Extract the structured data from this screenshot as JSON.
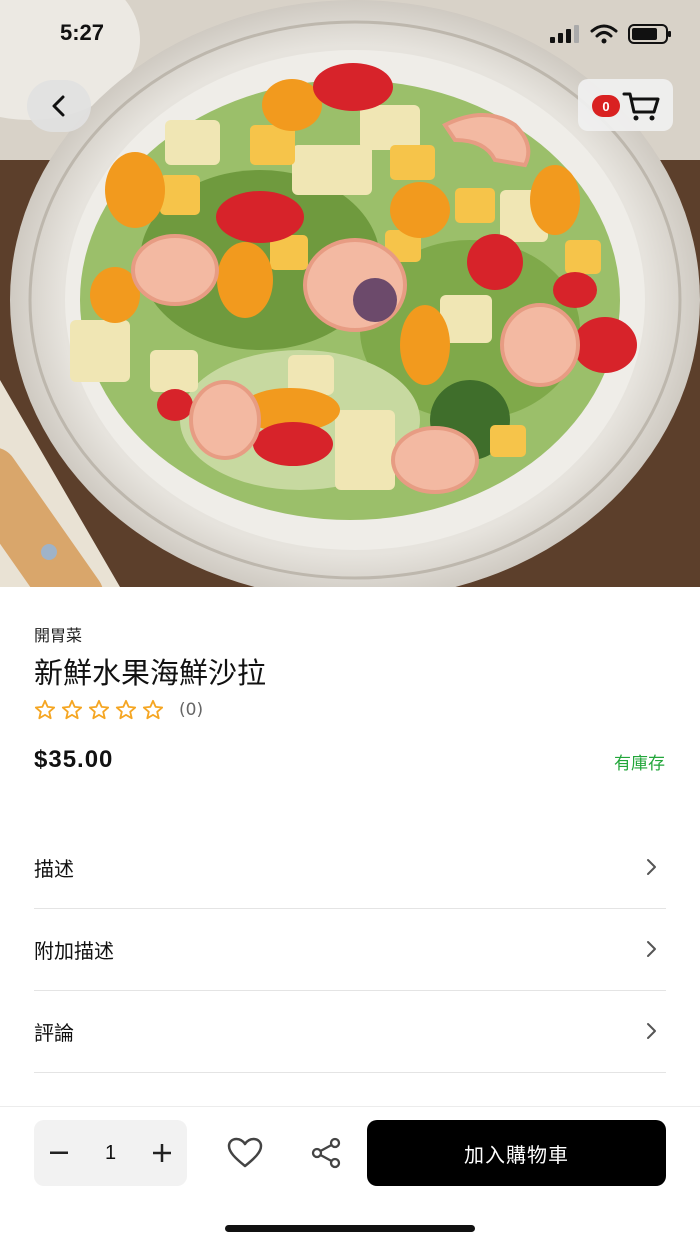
{
  "status_bar": {
    "time": "5:27"
  },
  "header": {
    "cart_count": "0"
  },
  "product": {
    "category": "開胃菜",
    "title": "新鮮水果海鮮沙拉",
    "rating_count": "(0)",
    "rating_value": 0,
    "rating_max": 5,
    "price": "$35.00",
    "stock_status": "有庫存"
  },
  "sections": [
    {
      "label": "描述"
    },
    {
      "label": "附加描述"
    },
    {
      "label": "評論"
    }
  ],
  "footer": {
    "quantity": "1",
    "decrement_label": "−",
    "increment_label": "+",
    "add_to_cart_label": "加入購物車"
  },
  "colors": {
    "accent_star": "#f5a623",
    "stock_green": "#22a63a",
    "badge_red": "#d92121",
    "button_black": "#000000"
  },
  "icons": [
    "back-arrow-icon",
    "cart-icon",
    "star-icon",
    "chevron-right-icon",
    "minus-icon",
    "plus-icon",
    "heart-icon",
    "share-icon",
    "signal-icon",
    "wifi-icon",
    "battery-icon"
  ]
}
